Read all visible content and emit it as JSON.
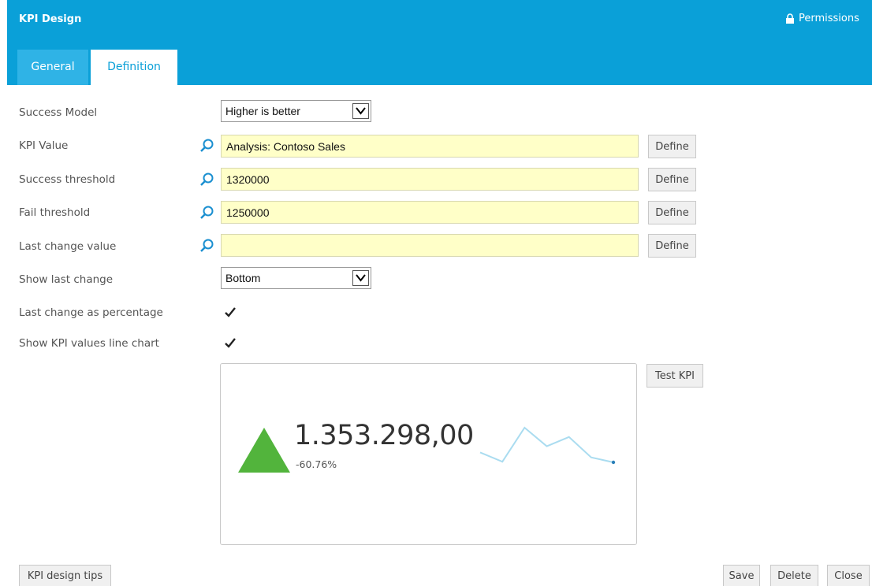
{
  "header": {
    "title": "KPI Design",
    "permissions": "Permissions"
  },
  "tabs": [
    {
      "label": "General",
      "active": false
    },
    {
      "label": "Definition",
      "active": true
    }
  ],
  "form": {
    "success_model": {
      "label": "Success Model",
      "value": "Higher is better"
    },
    "kpi_value": {
      "label": "KPI Value",
      "value": "Analysis: Contoso Sales",
      "define": "Define"
    },
    "success_threshold": {
      "label": "Success threshold",
      "value": "1320000",
      "define": "Define"
    },
    "fail_threshold": {
      "label": "Fail threshold",
      "value": "1250000",
      "define": "Define"
    },
    "last_change_value": {
      "label": "Last change value",
      "value": "",
      "define": "Define"
    },
    "show_last_change": {
      "label": "Show last change",
      "value": "Bottom"
    },
    "last_change_pct": {
      "label": "Last change as percentage",
      "checked": true
    },
    "show_line_chart": {
      "label": "Show KPI values line chart",
      "checked": true
    }
  },
  "preview": {
    "value": "1.353.298,00",
    "change": "-60.76%",
    "status_color": "#52b43c",
    "sparkline_color": "#aadcf0",
    "sparkline": [
      30,
      15,
      70,
      40,
      55,
      22,
      14
    ],
    "test_label": "Test KPI"
  },
  "footer": {
    "tips": "KPI design tips",
    "save": "Save",
    "delete": "Delete",
    "close": "Close"
  },
  "colors": {
    "accent": "#0aa0d8",
    "tab_inactive": "#2fb3e6",
    "input_bg": "#ffffc8"
  }
}
